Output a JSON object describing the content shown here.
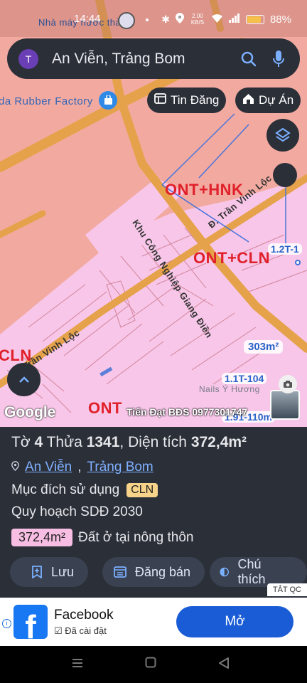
{
  "status_bar": {
    "time": "14:44",
    "net_speed": "2.00 KB/S",
    "battery": "88%"
  },
  "search": {
    "avatar_letter": "T",
    "query": "An Viễn, Trảng Bom"
  },
  "chips": {
    "news": "Tin Đăng",
    "projects": "Dự Án"
  },
  "map": {
    "poi_factory": "da Rubber Factory",
    "poi_top": "Nhà máy nước thải",
    "zone_labels": {
      "a": "ONT+HNK",
      "b": "ONT+CLN",
      "c": "CLN",
      "d": "ONT"
    },
    "industrial_zone": "Khu Công Nghiệp Giang Điền",
    "street_1": "Đ. Trần Vinh Lộc",
    "street_2": "Đ. Trần Vinh Lộc",
    "lot_label_1": "1.2T-1",
    "lot_label_2": "1.1T-104",
    "lot_label_3": "1.91-110m",
    "area_badge": "303m²",
    "nails_label": "Nails Ý Hương",
    "google_logo": "Google",
    "watermark": "Tiến Đạt BĐS 0977301747"
  },
  "info": {
    "sheet_label": "Tờ",
    "sheet_no": "4",
    "parcel_label": "Thửa",
    "parcel_no": "1341",
    "area_label": "Diện tích",
    "area_value": "372,4m²",
    "ward": "An Viễn",
    "district": "Trảng Bom",
    "purpose_label": "Mục đích sử dụng",
    "purpose_code": "CLN",
    "plan": "Quy hoạch SDĐ 2030",
    "plan_area": "372,4m²",
    "plan_type": "Đất ở tại nông thôn"
  },
  "actions": {
    "save": "Lưu",
    "post": "Đăng bán",
    "note": "Chú thích"
  },
  "ad": {
    "close": "TẮT QC",
    "app_name": "Facebook",
    "installed": "Đã cài đặt",
    "open": "Mở"
  },
  "colors": {
    "zone_pink": "#f2aaa0",
    "residential": "#f7c6e8",
    "road": "#e8a24a",
    "panel": "#2b2f38",
    "accent_blue": "#1a5cd6"
  }
}
